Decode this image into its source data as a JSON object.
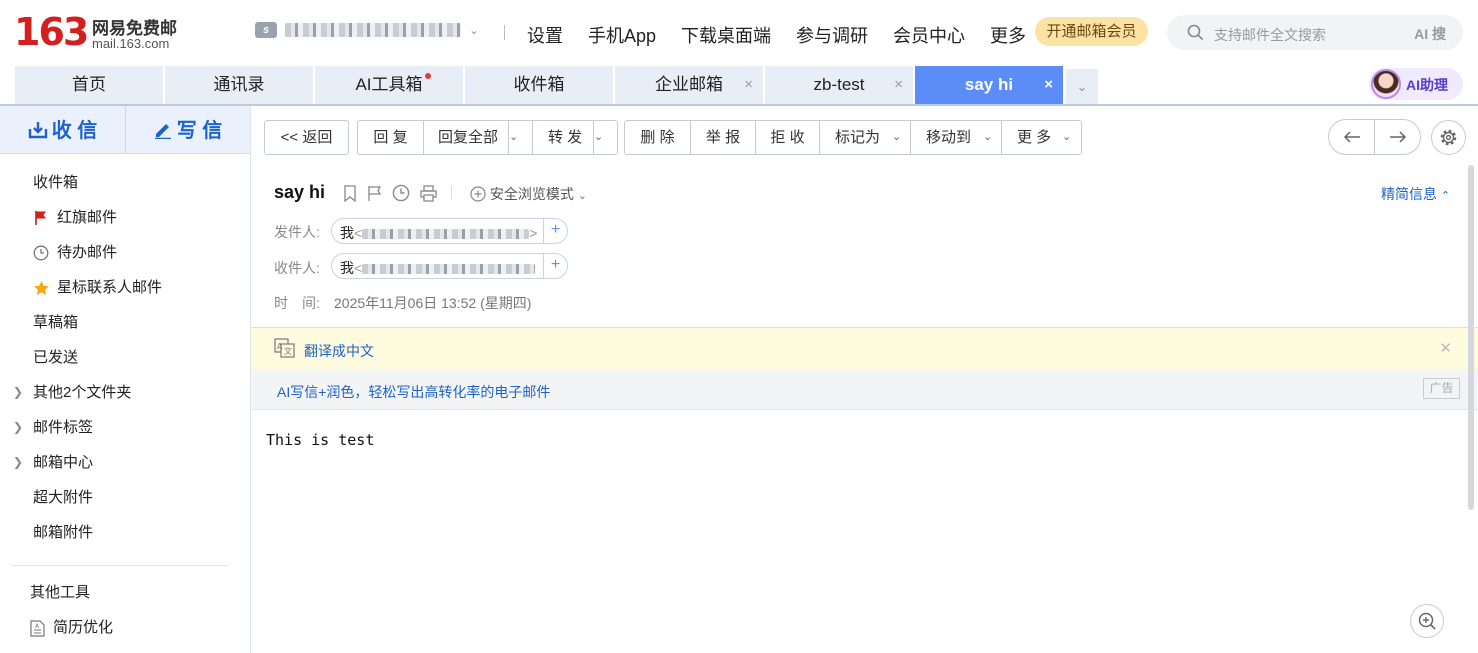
{
  "logo": {
    "number": "163",
    "cn": "网易免费邮",
    "domain": "mail.163.com"
  },
  "account": {
    "icon": "s"
  },
  "topnav": [
    "设置",
    "手机App",
    "下载桌面端",
    "参与调研",
    "会员中心",
    "更多"
  ],
  "vip_button": "开通邮箱会员",
  "search": {
    "placeholder": "支持邮件全文搜索",
    "ai_label": "AI 搜"
  },
  "tabs": [
    {
      "label": "首页",
      "closable": false
    },
    {
      "label": "通讯录",
      "closable": false
    },
    {
      "label": "AI工具箱",
      "closable": false,
      "dot": true
    },
    {
      "label": "收件箱",
      "closable": false
    },
    {
      "label": "企业邮箱",
      "closable": true
    },
    {
      "label": "zb-test",
      "closable": true
    },
    {
      "label": "say hi",
      "closable": true,
      "active": true
    }
  ],
  "tab_close": "×",
  "ai_assistant": "AI助理",
  "compose": {
    "receive": "收 信",
    "write": "写 信"
  },
  "folders": {
    "inbox": "收件箱",
    "flagged": "红旗邮件",
    "todo": "待办邮件",
    "starred": "星标联系人邮件",
    "drafts": "草稿箱",
    "sent": "已发送",
    "other_folders": "其他2个文件夹",
    "labels": "邮件标签",
    "center": "邮箱中心",
    "large_attach": "超大附件",
    "attachments": "邮箱附件",
    "other_tools": "其他工具",
    "resume": "简历优化"
  },
  "toolbar": {
    "back": "<< 返回",
    "reply": "回 复",
    "reply_all": "回复全部",
    "forward": "转 发",
    "delete": "删 除",
    "report": "举 报",
    "reject": "拒 收",
    "mark_as": "标记为",
    "move_to": "移动到",
    "more": "更 多"
  },
  "mail": {
    "subject": "say hi",
    "safe_mode": "安全浏览模式",
    "brief_info": "精简信息",
    "from_label": "发件人:",
    "to_label": "收件人:",
    "time_label": "时　间:",
    "sender_name": "我",
    "recipient_name": "我",
    "time": "2025年11月06日 13:52 (星期四)",
    "body": "This is test"
  },
  "translate": "翻译成中文",
  "ad": {
    "text": "AI写信+润色，轻松写出高转化率的电子邮件",
    "tag": "广告"
  },
  "colors": {
    "brand_red": "#d41f1f",
    "active_tab": "#5b8cf8",
    "link_blue": "#1d63c9"
  }
}
